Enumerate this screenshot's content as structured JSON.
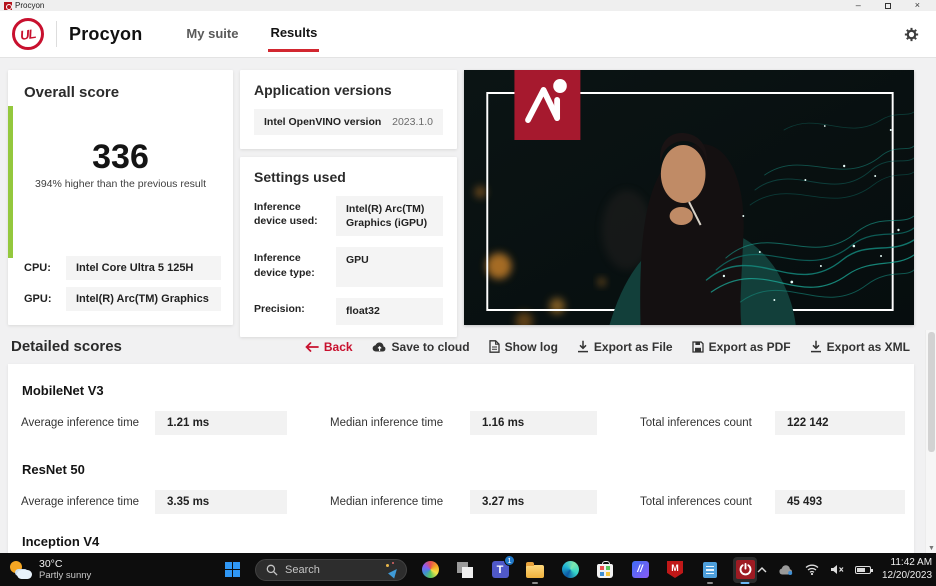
{
  "colors": {
    "accent_red": "#c8102e",
    "score_green": "#94c83d",
    "taskbar_bg": "#0d0d0d"
  },
  "window": {
    "title": "Procyon",
    "minimize_glyph": "–",
    "close_glyph": "×"
  },
  "nav": {
    "logo_text": "UL",
    "brand": "Procyon",
    "tabs": [
      {
        "label": "My suite"
      },
      {
        "label": "Results"
      }
    ]
  },
  "overall_score": {
    "title": "Overall score",
    "score": "336",
    "comparison": "394% higher than the previous result",
    "cpu_label": "CPU:",
    "cpu_value": "Intel Core Ultra 5 125H",
    "gpu_label": "GPU:",
    "gpu_value": "Intel(R) Arc(TM) Graphics"
  },
  "application_versions": {
    "title": "Application versions",
    "rows": [
      {
        "label": "Intel OpenVINO version",
        "value": "2023.1.0"
      }
    ]
  },
  "settings_used": {
    "title": "Settings used",
    "rows": [
      {
        "label": "Inference device used:",
        "value": "Intel(R) Arc(TM) Graphics (iGPU)"
      },
      {
        "label": "Inference device type:",
        "value": "GPU"
      },
      {
        "label": "Precision:",
        "value": "float32"
      }
    ]
  },
  "detailed_scores": {
    "title": "Detailed scores",
    "actions": [
      {
        "label": "Back",
        "icon": "arrow-left"
      },
      {
        "label": "Save to cloud",
        "icon": "cloud-upload"
      },
      {
        "label": "Show log",
        "icon": "document"
      },
      {
        "label": "Export as File",
        "icon": "download"
      },
      {
        "label": "Export as PDF",
        "icon": "save"
      },
      {
        "label": "Export as XML",
        "icon": "download"
      }
    ],
    "metric_labels": {
      "avg": "Average inference time",
      "median": "Median inference time",
      "total": "Total inferences count"
    },
    "models": [
      {
        "name": "MobileNet V3",
        "avg": "1.21 ms",
        "median": "1.16 ms",
        "total": "122 142"
      },
      {
        "name": "ResNet 50",
        "avg": "3.35 ms",
        "median": "3.27 ms",
        "total": "45 493"
      },
      {
        "name": "Inception V4"
      }
    ]
  },
  "taskbar": {
    "weather": {
      "temp": "30°C",
      "condition": "Partly sunny"
    },
    "search_placeholder": "Search",
    "teams_badge": "1",
    "apps": [
      "photos",
      "task-view",
      "teams",
      "file-explorer",
      "edge",
      "microsoft-store",
      "microsoft-365",
      "mcafee",
      "notepad",
      "procyon"
    ],
    "clock": {
      "time": "11:42 AM",
      "date": "12/20/2023"
    }
  }
}
